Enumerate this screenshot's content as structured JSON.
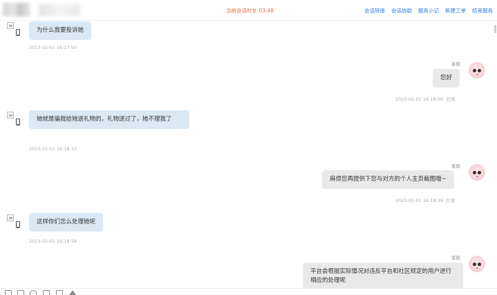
{
  "header": {
    "session_duration": "当前会话时长 03:48",
    "actions": [
      "会话转接",
      "会话协助",
      "服务小记",
      "新建工单",
      "结束服务"
    ]
  },
  "messages": [
    {
      "from": "user",
      "text": "为什么我要投诉她",
      "time": "2023-02-01 16:17:50"
    },
    {
      "from": "agent",
      "label": "客服",
      "text": "您好",
      "time": "2023-02-01 16:18:00",
      "status": "已读"
    },
    {
      "from": "user",
      "text": "她就是骗我给她送礼物的，礼物送过了，她不理我了",
      "time": "2023-02-01 16:18:33"
    },
    {
      "from": "agent",
      "label": "客服",
      "text": "麻烦您再提供下您与对方的个人主页截图哦~",
      "time": "2023-02-01 16:18:39",
      "status": "已读"
    },
    {
      "from": "user",
      "text": "这样你们怎么处理她呢",
      "time": "2023-02-01 16:18:58"
    },
    {
      "from": "agent",
      "label": "客服",
      "text": "平台会根据实际情况对违反平台和社区规定的用户进行相应的处理呢"
    }
  ],
  "toolbar": {
    "icons": [
      "emoji-icon",
      "image-icon",
      "smile-icon",
      "file-icon",
      "quick-reply-icon",
      "star-icon"
    ]
  }
}
